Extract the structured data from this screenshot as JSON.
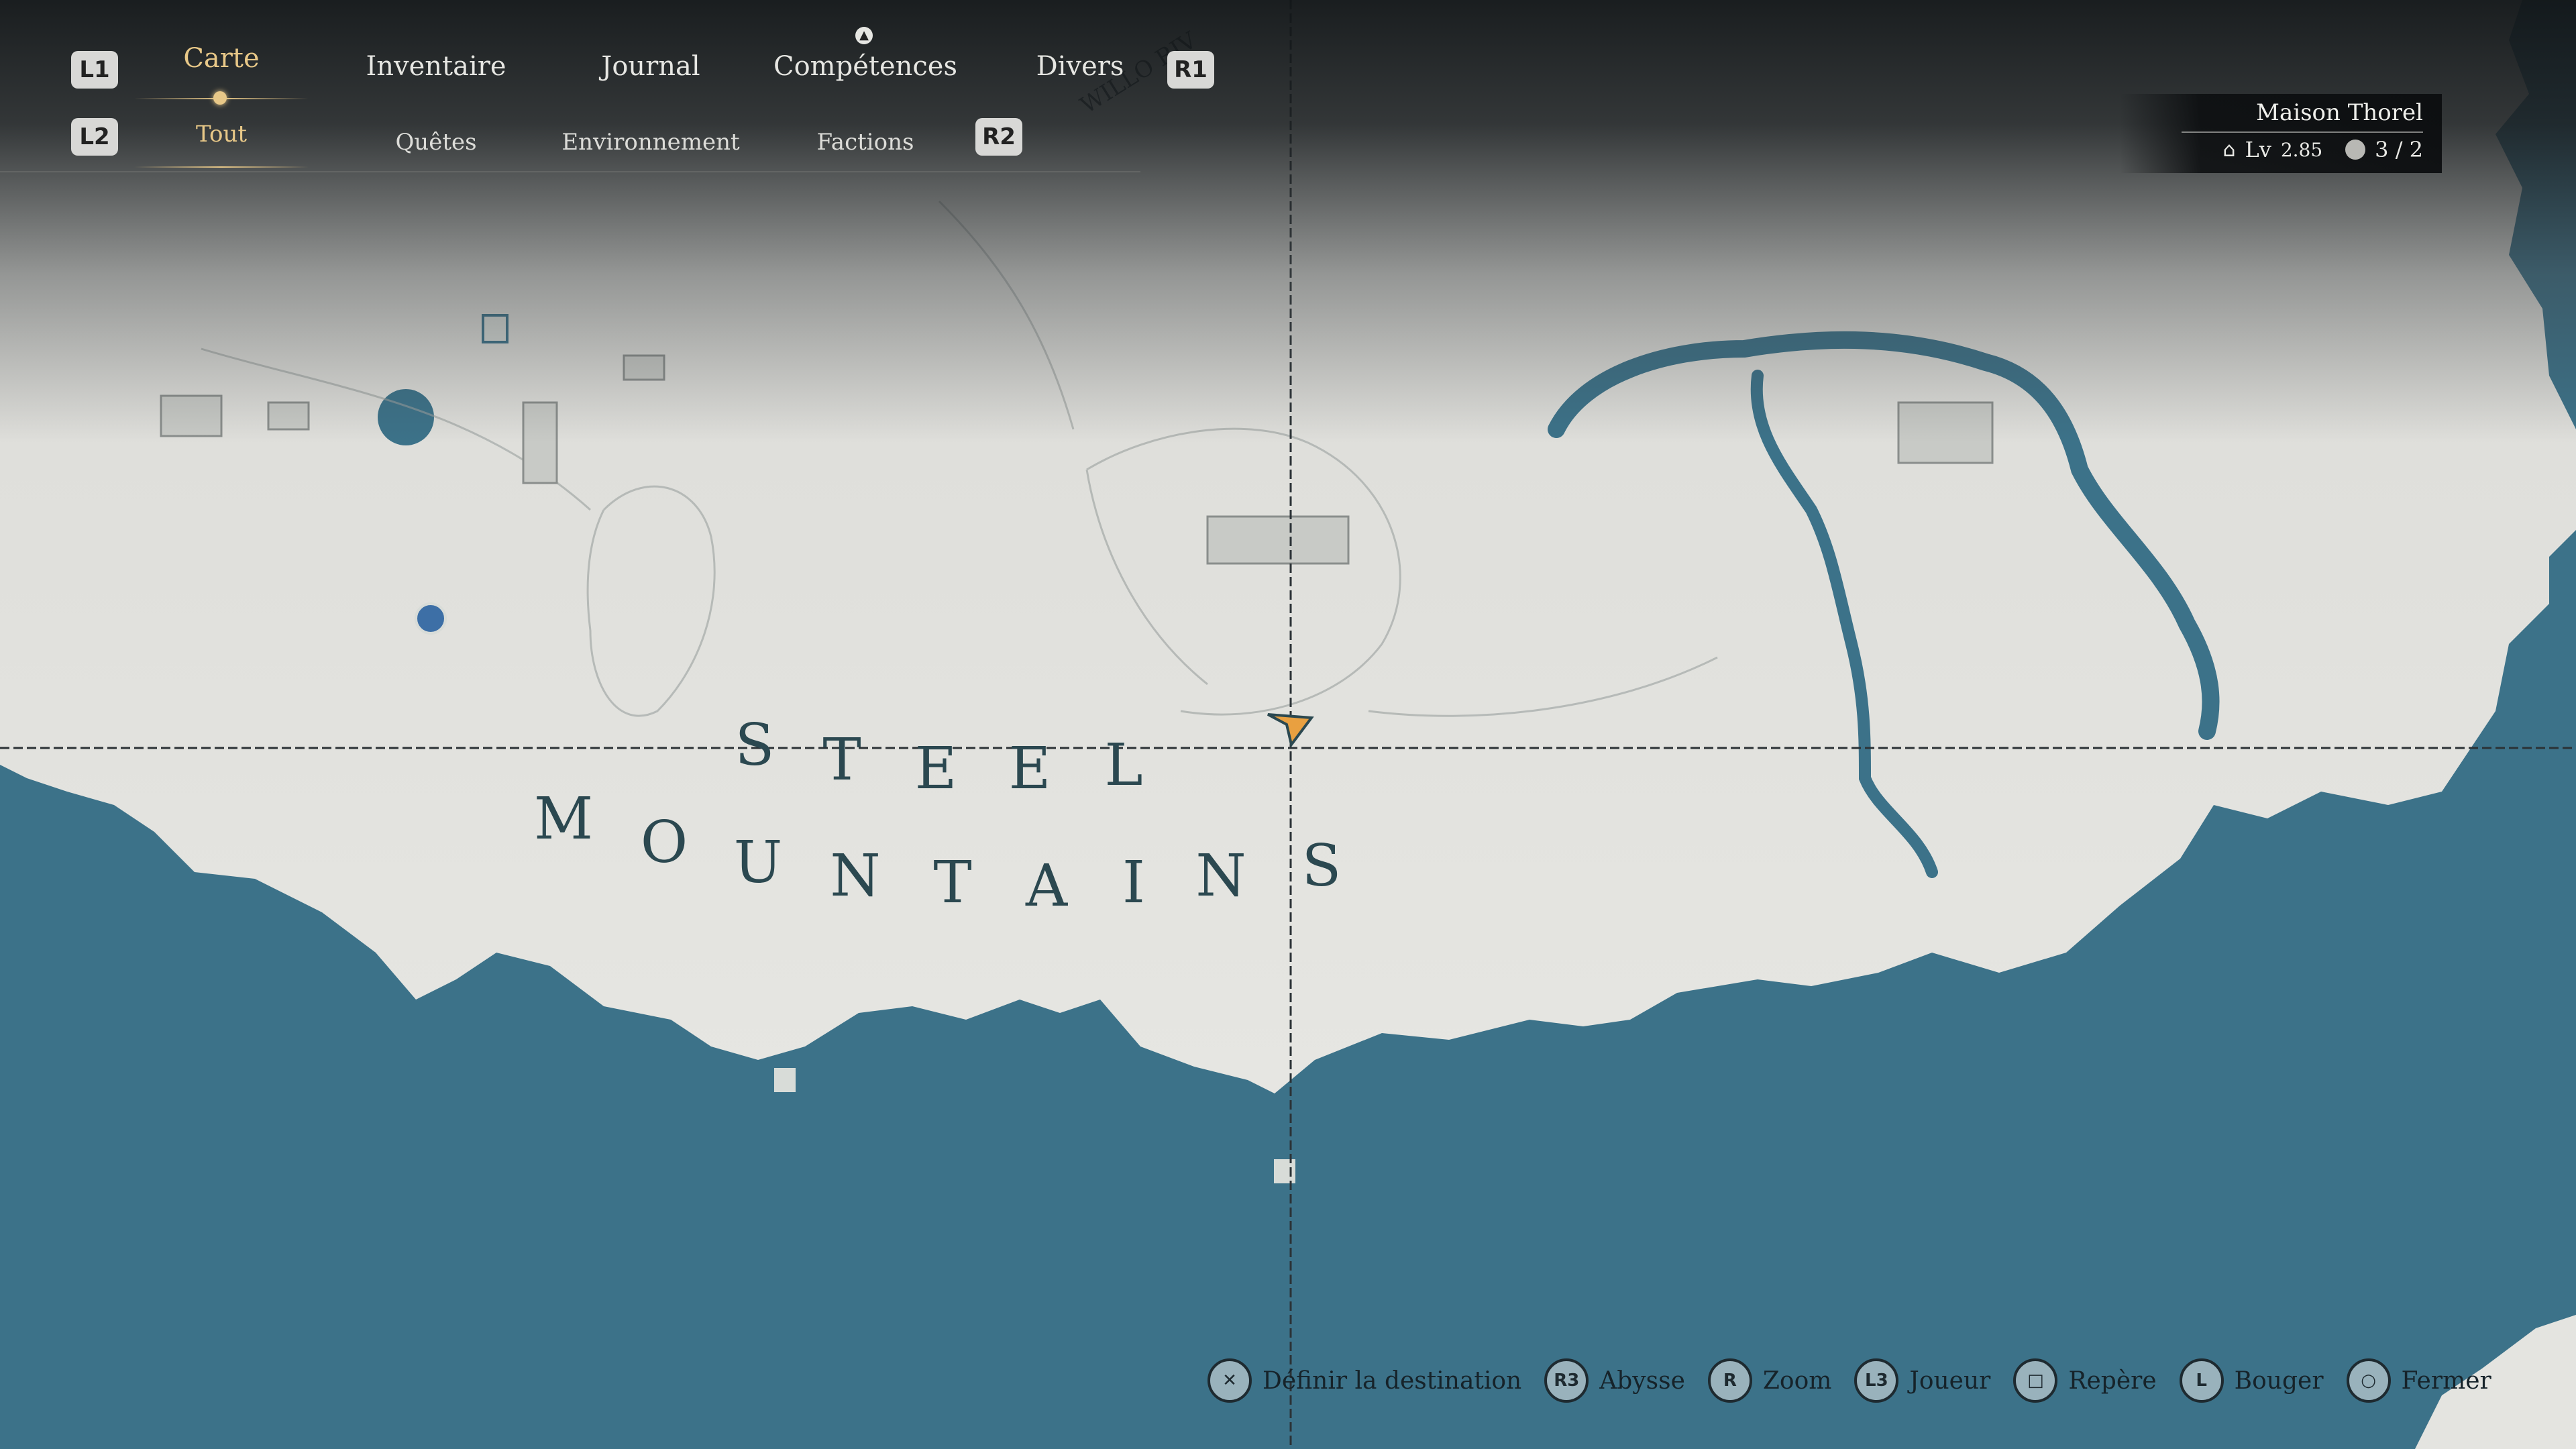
{
  "nav": {
    "l1": "L1",
    "r1": "R1",
    "l2": "L2",
    "r2": "R2",
    "tabs": [
      "Carte",
      "Inventaire",
      "Journal",
      "Compétences",
      "Divers"
    ],
    "active_tab": "Carte",
    "subtabs": [
      "Tout",
      "Quêtes",
      "Environnement",
      "Factions"
    ],
    "active_subtab": "Tout"
  },
  "location": {
    "name": "Maison  Thorel",
    "level_label": "Lv",
    "level_value": "2.85",
    "count": "3 / 2"
  },
  "map": {
    "region_label_line1": [
      "S",
      "T",
      "E",
      "E",
      "L"
    ],
    "region_label_line2": [
      "M",
      "O",
      "U",
      "N",
      "T",
      "A",
      "I",
      "N",
      "S"
    ],
    "river_text": "WILLO RIV"
  },
  "hints": [
    {
      "button": "✕",
      "label": "Définir  la  destination"
    },
    {
      "button": "R3",
      "label": "Abysse"
    },
    {
      "button": "R",
      "label": "Zoom"
    },
    {
      "button": "L3",
      "label": "Joueur"
    },
    {
      "button": "□",
      "label": "Repère"
    },
    {
      "button": "L",
      "label": "Bouger"
    },
    {
      "button": "○",
      "label": "Fermer"
    }
  ],
  "colors": {
    "sea": "#3c7289",
    "land": "#e4e4e0",
    "accent": "#e8c888",
    "player_marker": "#e9a040"
  }
}
